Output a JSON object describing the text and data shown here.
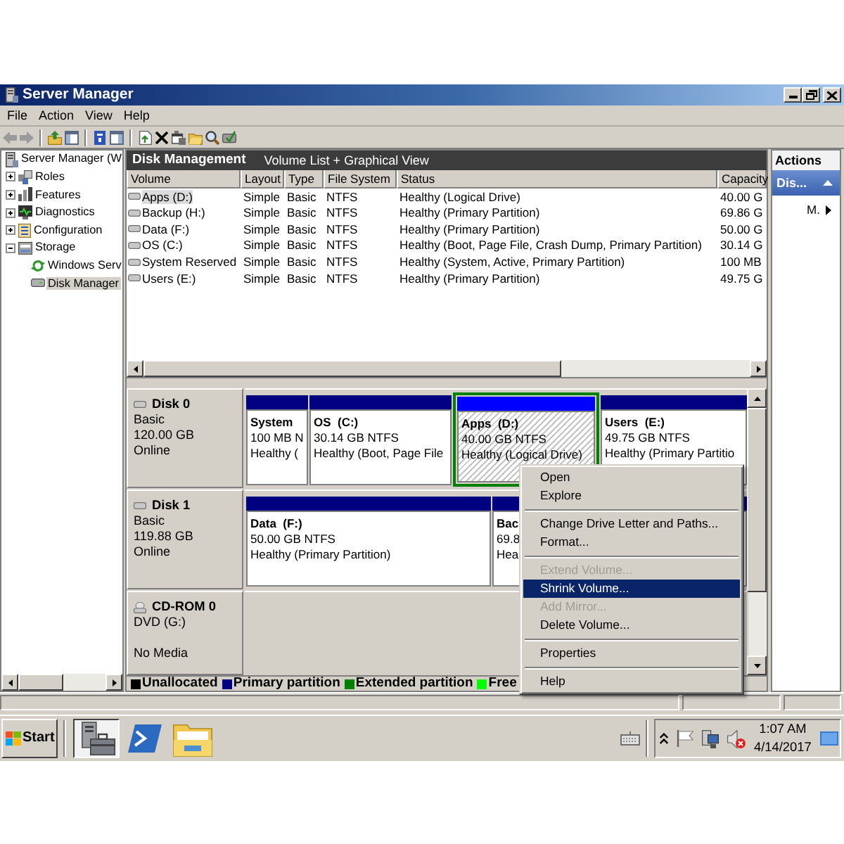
{
  "window": {
    "title": "Server Manager"
  },
  "menu_bar": [
    {
      "label": "File"
    },
    {
      "label": "Action"
    },
    {
      "label": "View"
    },
    {
      "label": "Help"
    }
  ],
  "tree": {
    "items": [
      {
        "kind": "server",
        "label": "Server Manager (W",
        "selected": false,
        "children": [
          {
            "kind": "roles",
            "label": "Roles",
            "expanded": false,
            "selected": false
          },
          {
            "kind": "features",
            "label": "Features",
            "expanded": false,
            "selected": false
          },
          {
            "kind": "diagnostics",
            "label": "Diagnostics",
            "expanded": false,
            "selected": false
          },
          {
            "kind": "configuration",
            "label": "Configuration",
            "expanded": false,
            "selected": false
          },
          {
            "kind": "storage",
            "label": "Storage",
            "expanded": true,
            "selected": false,
            "children": [
              {
                "kind": "backup",
                "label": "Windows Serv",
                "selected": false
              },
              {
                "kind": "disk",
                "label": "Disk Manager",
                "selected": true
              }
            ]
          }
        ]
      }
    ]
  },
  "pane_header": {
    "title": "Disk Management",
    "subtitle": "Volume List + Graphical View"
  },
  "volume_table": {
    "columns": [
      "Volume",
      "Layout",
      "Type",
      "File System",
      "Status",
      "Capacity"
    ],
    "rows": [
      {
        "cells": [
          "Apps (D:)",
          "Simple",
          "Basic",
          "NTFS",
          "Healthy (Logical Drive)",
          "40.00 G"
        ],
        "selected": true
      },
      {
        "cells": [
          "Backup (H:)",
          "Simple",
          "Basic",
          "NTFS",
          "Healthy (Primary Partition)",
          "69.86 G"
        ],
        "selected": false
      },
      {
        "cells": [
          "Data (F:)",
          "Simple",
          "Basic",
          "NTFS",
          "Healthy (Primary Partition)",
          "50.00 G"
        ],
        "selected": false
      },
      {
        "cells": [
          "OS (C:)",
          "Simple",
          "Basic",
          "NTFS",
          "Healthy (Boot, Page File, Crash Dump, Primary Partition)",
          "30.14 G"
        ],
        "selected": false
      },
      {
        "cells": [
          "System Reserved",
          "Simple",
          "Basic",
          "NTFS",
          "Healthy (System, Active, Primary Partition)",
          "100 MB"
        ],
        "selected": false
      },
      {
        "cells": [
          "Users (E:)",
          "Simple",
          "Basic",
          "NTFS",
          "Healthy (Primary Partition)",
          "49.75 G"
        ],
        "selected": false
      }
    ]
  },
  "disks": [
    {
      "kind": "disk",
      "name": "Disk 0",
      "type": "Basic",
      "size": "120.00 GB",
      "status": "Online",
      "partitions": [
        {
          "kind": "primary",
          "name": "System",
          "size": "100 MB N",
          "status": "Healthy (",
          "selected": false
        },
        {
          "kind": "primary",
          "name": "OS  (C:)",
          "size": "30.14 GB NTFS",
          "status": "Healthy (Boot, Page File",
          "selected": false
        },
        {
          "kind": "logical",
          "name": "Apps  (D:)",
          "size": "40.00 GB NTFS",
          "status": "Healthy (Logical Drive)",
          "selected": true
        },
        {
          "kind": "primary",
          "name": "Users  (E:)",
          "size": "49.75 GB NTFS",
          "status": "Healthy (Primary Partitio",
          "selected": false
        }
      ]
    },
    {
      "kind": "disk",
      "name": "Disk 1",
      "type": "Basic",
      "size": "119.88 GB",
      "status": "Online",
      "partitions": [
        {
          "kind": "primary",
          "name": "Data  (F:)",
          "size": "50.00 GB NTFS",
          "status": "Healthy (Primary Partition)",
          "selected": false
        },
        {
          "kind": "primary",
          "name": "Bac",
          "size": "69.8",
          "status": "Hea",
          "selected": false
        }
      ]
    },
    {
      "kind": "cdrom",
      "name": "CD-ROM 0",
      "type": "DVD (G:)",
      "status": "No Media"
    }
  ],
  "legend": [
    {
      "label": "Unallocated",
      "color": "#000000"
    },
    {
      "label": "Primary partition",
      "color": "#000080"
    },
    {
      "label": "Extended partition",
      "color": "#008000"
    },
    {
      "label": "Free",
      "color": "#00ff00"
    }
  ],
  "actions": {
    "title": "Actions",
    "section": {
      "label": "Dis...",
      "expanded": true
    },
    "items": [
      {
        "label": "M.",
        "submenu": true
      }
    ]
  },
  "context_menu": {
    "items": [
      {
        "kind": "item",
        "label": "Open",
        "disabled": false,
        "selected": false
      },
      {
        "kind": "item",
        "label": "Explore",
        "disabled": false,
        "selected": false
      },
      {
        "kind": "separator"
      },
      {
        "kind": "item",
        "label": "Change Drive Letter and Paths...",
        "disabled": false,
        "selected": false
      },
      {
        "kind": "item",
        "label": "Format...",
        "disabled": false,
        "selected": false
      },
      {
        "kind": "separator"
      },
      {
        "kind": "item",
        "label": "Extend Volume...",
        "disabled": true,
        "selected": false
      },
      {
        "kind": "item",
        "label": "Shrink Volume...",
        "disabled": false,
        "selected": true
      },
      {
        "kind": "item",
        "label": "Add Mirror...",
        "disabled": true,
        "selected": false
      },
      {
        "kind": "item",
        "label": "Delete Volume...",
        "disabled": false,
        "selected": false
      },
      {
        "kind": "separator"
      },
      {
        "kind": "item",
        "label": "Properties",
        "disabled": false,
        "selected": false
      },
      {
        "kind": "separator"
      },
      {
        "kind": "item",
        "label": "Help",
        "disabled": false,
        "selected": false
      }
    ]
  },
  "taskbar": {
    "start": "Start",
    "apps": [
      {
        "kind": "server-manager",
        "selected": true
      },
      {
        "kind": "powershell",
        "selected": false
      },
      {
        "kind": "explorer",
        "selected": false
      }
    ],
    "clock": {
      "time": "1:07 AM",
      "date": "4/14/2017"
    }
  }
}
